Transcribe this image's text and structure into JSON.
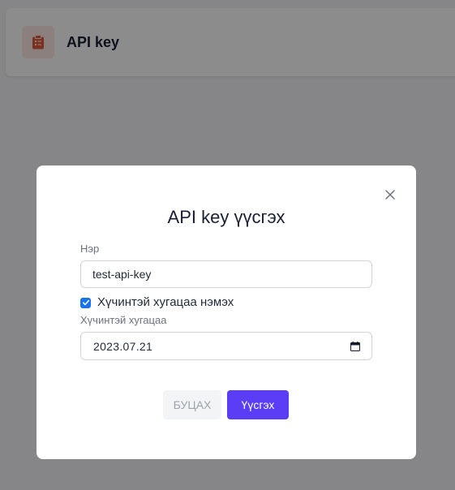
{
  "header": {
    "title": "API key",
    "icon": "clipboard-list-icon",
    "icon_color": "#e05a3a",
    "icon_bg": "#fde9e4"
  },
  "modal": {
    "title": "API key үүсгэх",
    "name_field": {
      "label": "Нэр",
      "value": "test-api-key"
    },
    "expiry_checkbox": {
      "label": "Хүчинтэй хугацаа нэмэх",
      "checked": true
    },
    "expiry_field": {
      "label": "Хүчинтэй хугацаа",
      "value": "2023.07.21"
    },
    "buttons": {
      "cancel": "БУЦАХ",
      "create": "Үүсгэх"
    },
    "close_icon": "close-icon"
  },
  "colors": {
    "accent": "#5b3df5",
    "checkbox": "#1a73e8",
    "overlay": "rgba(0,0,0,0.45)"
  }
}
